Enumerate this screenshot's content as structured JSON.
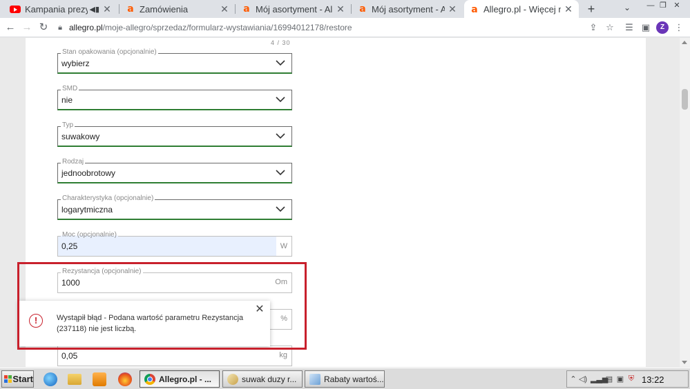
{
  "tabs": [
    {
      "title": "Kampania prezydenc",
      "favicon": "youtube-icon",
      "has_audio": true,
      "active": false
    },
    {
      "title": "Zamówienia",
      "favicon": "allegro-icon",
      "active": false
    },
    {
      "title": "Mój asortyment - Allegr",
      "favicon": "allegro-icon",
      "active": false
    },
    {
      "title": "Mój asortyment - Allegr",
      "favicon": "allegro-icon",
      "active": false
    },
    {
      "title": "Allegro.pl - Więcej niż",
      "favicon": "allegro-icon",
      "active": true
    }
  ],
  "address_bar": {
    "host": "allegro.pl",
    "path": "/moje-allegro/sprzedaz/formularz-wystawiania/16994012178/restore"
  },
  "profile_initial": "Z",
  "form": {
    "char_counter": "4 / 30",
    "fields": [
      {
        "label": "Stan opakowania (opcjonalnie)",
        "value": "wybierz",
        "kind": "select"
      },
      {
        "label": "SMD",
        "value": "nie",
        "kind": "select"
      },
      {
        "label": "Typ",
        "value": "suwakowy",
        "kind": "select"
      },
      {
        "label": "Rodzaj",
        "value": "jednoobrotowy",
        "kind": "select"
      },
      {
        "label": "Charakterystyka (opcjonalnie)",
        "value": "logarytmiczna",
        "kind": "select"
      },
      {
        "label": "Moc (opcjonalnie)",
        "value": "0,25",
        "unit": "W",
        "kind": "input"
      },
      {
        "label": "Rezystancja (opcjonalnie)",
        "value": "1000",
        "unit": "Om",
        "kind": "input"
      },
      {
        "label": "",
        "value": "",
        "unit": "%",
        "kind": "input"
      },
      {
        "label": "",
        "value": "0,05",
        "unit": "kg",
        "kind": "input"
      }
    ]
  },
  "error_toast": {
    "message": "Wystąpił błąd - Podana wartość parametru Rezystancja (237118) nie jest liczbą.",
    "close_label": "✕"
  },
  "colors": {
    "accent_green": "#2e7d32",
    "error_red": "#c8202c",
    "allegro_orange": "#ff5a00"
  },
  "taskbar": {
    "start_label": "Start",
    "tasks": [
      {
        "label": "Allegro.pl - ...",
        "active": true
      },
      {
        "label": "suwak duzy r...",
        "active": false
      },
      {
        "label": "Rabaty wartoś...",
        "active": false
      }
    ],
    "clock": "13:22"
  }
}
